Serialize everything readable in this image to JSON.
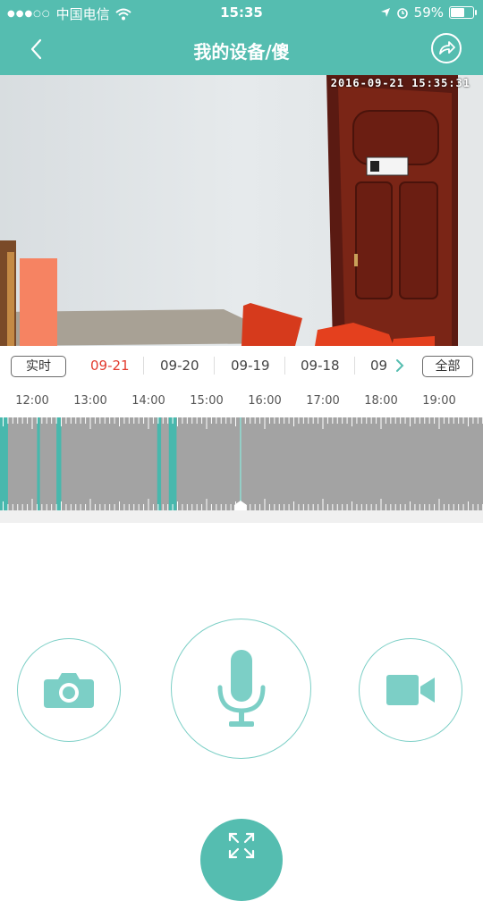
{
  "status_bar": {
    "carrier": "中国电信",
    "time": "15:35",
    "battery_text": "59%",
    "battery_level": 0.59
  },
  "nav": {
    "title": "我的设备/傻",
    "back_icon": "chevron-left-icon",
    "share_icon": "share-icon"
  },
  "video": {
    "timestamp": "2016-09-21  15:35:31",
    "door_sign": "会议室"
  },
  "date_bar": {
    "live_label": "实时",
    "all_label": "全部",
    "dates": [
      "09-21",
      "09-20",
      "09-19",
      "09-18",
      "09"
    ],
    "selected_date": "09-21"
  },
  "timeline": {
    "hours": [
      "12:00",
      "13:00",
      "14:00",
      "15:00",
      "16:00",
      "17:00",
      "18:00",
      "19:00"
    ],
    "recordings": [
      {
        "start": "11:25",
        "end": "11:35"
      },
      {
        "start": "12:05",
        "end": "12:08"
      },
      {
        "start": "12:25",
        "end": "12:30"
      },
      {
        "start": "14:09",
        "end": "14:13"
      },
      {
        "start": "14:21",
        "end": "14:29"
      }
    ],
    "current_time": "15:35"
  },
  "controls": {
    "snapshot_icon": "camera-icon",
    "talk_icon": "microphone-icon",
    "record_icon": "video-camera-icon",
    "fullscreen_icon": "expand-icon"
  },
  "colors": {
    "accent": "#55bdb0",
    "selected_date": "#e23c2f",
    "track": "#a3a3a3",
    "recording": "#48b8ad"
  }
}
